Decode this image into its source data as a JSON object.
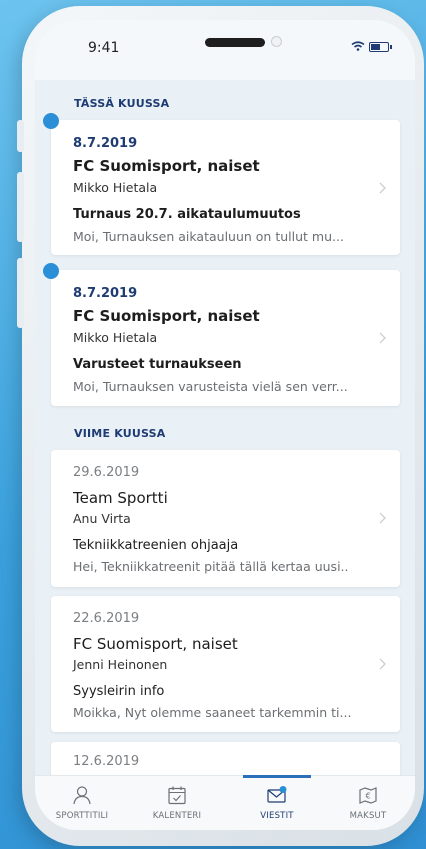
{
  "status": {
    "time": "9:41"
  },
  "sections": {
    "this_month": "TÄSSÄ KUUSSA",
    "last_month": "VIIME KUUSSA"
  },
  "messages": [
    {
      "date": "8.7.2019",
      "team": "FC Suomisport, naiset",
      "sender": "Mikko Hietala",
      "subject": "Turnaus 20.7. aikataulumuutos",
      "preview": "Moi, Turnauksen aikatauluun on tullut mu...",
      "unread": true
    },
    {
      "date": "8.7.2019",
      "team": "FC Suomisport, naiset",
      "sender": "Mikko Hietala",
      "subject": "Varusteet turnaukseen",
      "preview": "Moi, Turnauksen varusteista vielä sen verr...",
      "unread": true
    },
    {
      "date": "29.6.2019",
      "team": "Team Sportti",
      "sender": "Anu Virta",
      "subject": "Tekniikkatreenien ohjaaja",
      "preview": "Hei, Tekniikkatreenit pitää tällä kertaa uusi..",
      "unread": false
    },
    {
      "date": "22.6.2019",
      "team": "FC Suomisport, naiset",
      "sender": "Jenni Heinonen",
      "subject": "Syysleirin info",
      "preview": "Moikka, Nyt olemme saaneet tarkemmin ti...",
      "unread": false
    },
    {
      "date": "12.6.2019",
      "unread": false
    }
  ],
  "tabs": [
    {
      "label": "SPORTTITILI",
      "icon": "person-icon"
    },
    {
      "label": "KALENTERI",
      "icon": "calendar-icon"
    },
    {
      "label": "VIESTIT",
      "icon": "mail-icon",
      "active": true
    },
    {
      "label": "MAKSUT",
      "icon": "payment-icon"
    }
  ],
  "colors": {
    "accent": "#1f3b73",
    "unread_dot": "#2b8fd8",
    "background": "#e9f1f7"
  }
}
